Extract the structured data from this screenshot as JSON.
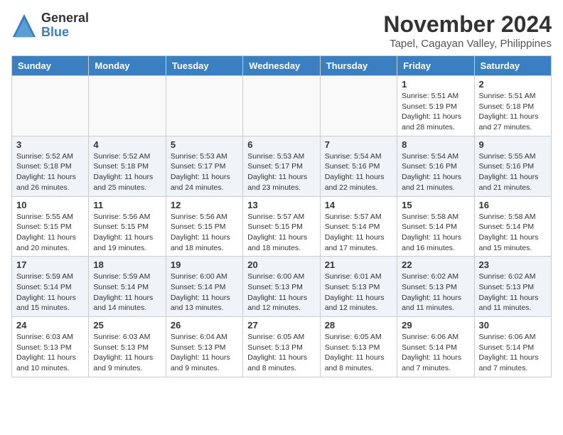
{
  "logo": {
    "general": "General",
    "blue": "Blue"
  },
  "title": "November 2024",
  "location": "Tapel, Cagayan Valley, Philippines",
  "days_header": [
    "Sunday",
    "Monday",
    "Tuesday",
    "Wednesday",
    "Thursday",
    "Friday",
    "Saturday"
  ],
  "weeks": [
    [
      {
        "day": "",
        "info": ""
      },
      {
        "day": "",
        "info": ""
      },
      {
        "day": "",
        "info": ""
      },
      {
        "day": "",
        "info": ""
      },
      {
        "day": "",
        "info": ""
      },
      {
        "day": "1",
        "info": "Sunrise: 5:51 AM\nSunset: 5:19 PM\nDaylight: 11 hours and 28 minutes."
      },
      {
        "day": "2",
        "info": "Sunrise: 5:51 AM\nSunset: 5:18 PM\nDaylight: 11 hours and 27 minutes."
      }
    ],
    [
      {
        "day": "3",
        "info": "Sunrise: 5:52 AM\nSunset: 5:18 PM\nDaylight: 11 hours and 26 minutes."
      },
      {
        "day": "4",
        "info": "Sunrise: 5:52 AM\nSunset: 5:18 PM\nDaylight: 11 hours and 25 minutes."
      },
      {
        "day": "5",
        "info": "Sunrise: 5:53 AM\nSunset: 5:17 PM\nDaylight: 11 hours and 24 minutes."
      },
      {
        "day": "6",
        "info": "Sunrise: 5:53 AM\nSunset: 5:17 PM\nDaylight: 11 hours and 23 minutes."
      },
      {
        "day": "7",
        "info": "Sunrise: 5:54 AM\nSunset: 5:16 PM\nDaylight: 11 hours and 22 minutes."
      },
      {
        "day": "8",
        "info": "Sunrise: 5:54 AM\nSunset: 5:16 PM\nDaylight: 11 hours and 21 minutes."
      },
      {
        "day": "9",
        "info": "Sunrise: 5:55 AM\nSunset: 5:16 PM\nDaylight: 11 hours and 21 minutes."
      }
    ],
    [
      {
        "day": "10",
        "info": "Sunrise: 5:55 AM\nSunset: 5:15 PM\nDaylight: 11 hours and 20 minutes."
      },
      {
        "day": "11",
        "info": "Sunrise: 5:56 AM\nSunset: 5:15 PM\nDaylight: 11 hours and 19 minutes."
      },
      {
        "day": "12",
        "info": "Sunrise: 5:56 AM\nSunset: 5:15 PM\nDaylight: 11 hours and 18 minutes."
      },
      {
        "day": "13",
        "info": "Sunrise: 5:57 AM\nSunset: 5:15 PM\nDaylight: 11 hours and 18 minutes."
      },
      {
        "day": "14",
        "info": "Sunrise: 5:57 AM\nSunset: 5:14 PM\nDaylight: 11 hours and 17 minutes."
      },
      {
        "day": "15",
        "info": "Sunrise: 5:58 AM\nSunset: 5:14 PM\nDaylight: 11 hours and 16 minutes."
      },
      {
        "day": "16",
        "info": "Sunrise: 5:58 AM\nSunset: 5:14 PM\nDaylight: 11 hours and 15 minutes."
      }
    ],
    [
      {
        "day": "17",
        "info": "Sunrise: 5:59 AM\nSunset: 5:14 PM\nDaylight: 11 hours and 15 minutes."
      },
      {
        "day": "18",
        "info": "Sunrise: 5:59 AM\nSunset: 5:14 PM\nDaylight: 11 hours and 14 minutes."
      },
      {
        "day": "19",
        "info": "Sunrise: 6:00 AM\nSunset: 5:14 PM\nDaylight: 11 hours and 13 minutes."
      },
      {
        "day": "20",
        "info": "Sunrise: 6:00 AM\nSunset: 5:13 PM\nDaylight: 11 hours and 12 minutes."
      },
      {
        "day": "21",
        "info": "Sunrise: 6:01 AM\nSunset: 5:13 PM\nDaylight: 11 hours and 12 minutes."
      },
      {
        "day": "22",
        "info": "Sunrise: 6:02 AM\nSunset: 5:13 PM\nDaylight: 11 hours and 11 minutes."
      },
      {
        "day": "23",
        "info": "Sunrise: 6:02 AM\nSunset: 5:13 PM\nDaylight: 11 hours and 11 minutes."
      }
    ],
    [
      {
        "day": "24",
        "info": "Sunrise: 6:03 AM\nSunset: 5:13 PM\nDaylight: 11 hours and 10 minutes."
      },
      {
        "day": "25",
        "info": "Sunrise: 6:03 AM\nSunset: 5:13 PM\nDaylight: 11 hours and 9 minutes."
      },
      {
        "day": "26",
        "info": "Sunrise: 6:04 AM\nSunset: 5:13 PM\nDaylight: 11 hours and 9 minutes."
      },
      {
        "day": "27",
        "info": "Sunrise: 6:05 AM\nSunset: 5:13 PM\nDaylight: 11 hours and 8 minutes."
      },
      {
        "day": "28",
        "info": "Sunrise: 6:05 AM\nSunset: 5:13 PM\nDaylight: 11 hours and 8 minutes."
      },
      {
        "day": "29",
        "info": "Sunrise: 6:06 AM\nSunset: 5:14 PM\nDaylight: 11 hours and 7 minutes."
      },
      {
        "day": "30",
        "info": "Sunrise: 6:06 AM\nSunset: 5:14 PM\nDaylight: 11 hours and 7 minutes."
      }
    ]
  ]
}
